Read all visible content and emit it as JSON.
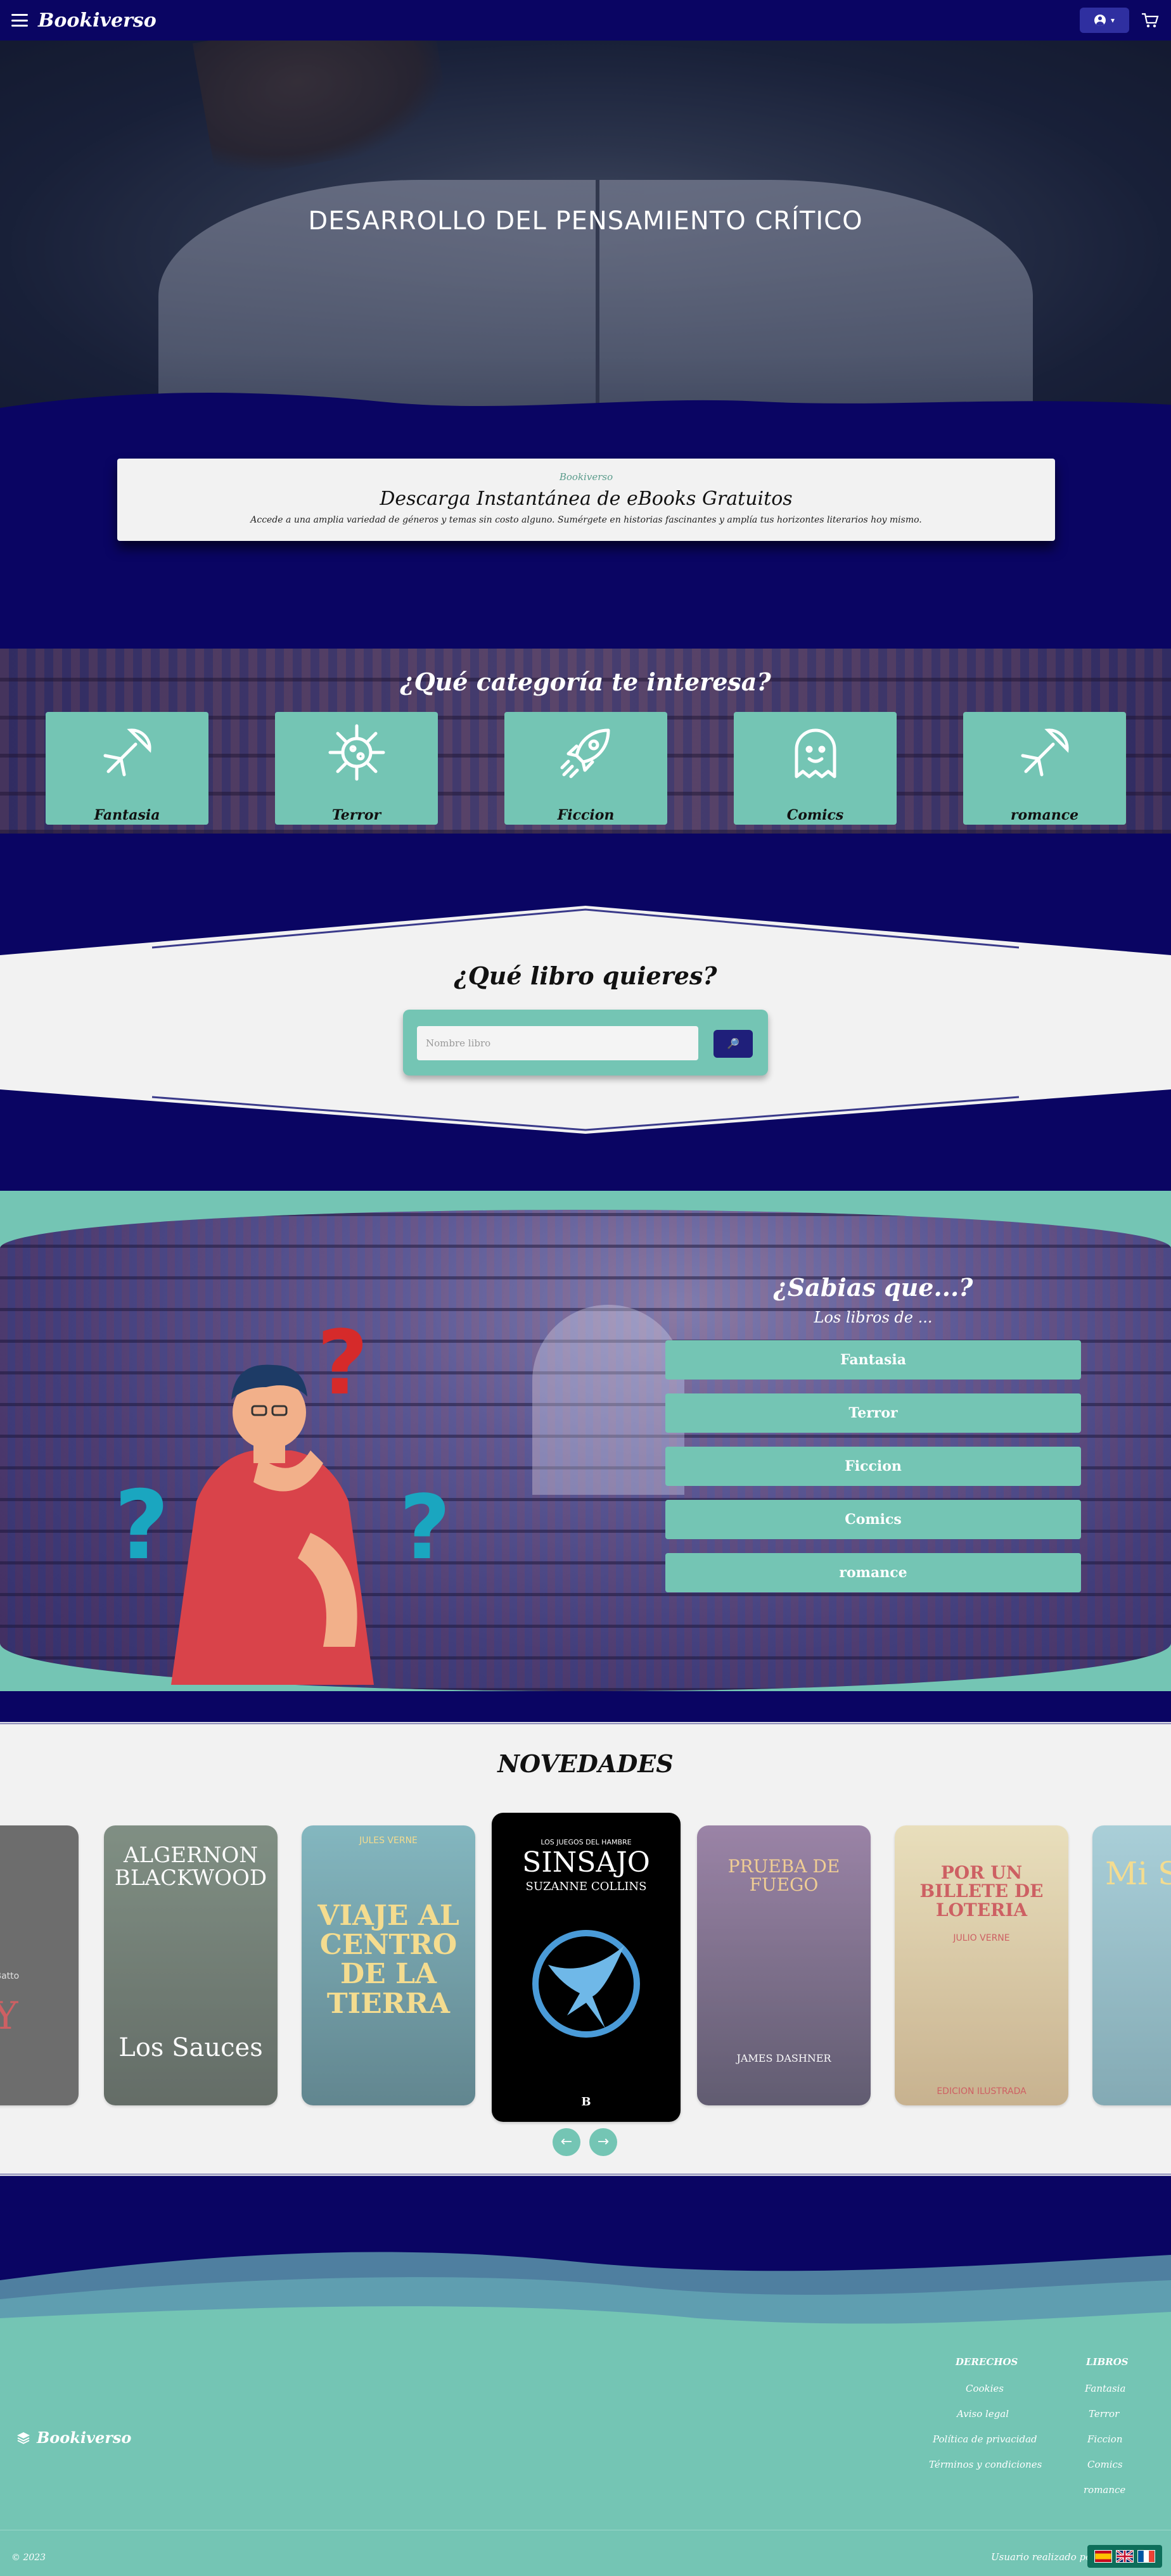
{
  "nav": {
    "brand": "Bookiverso",
    "user_caret": "▾"
  },
  "hero": {
    "title": "DESARROLLO DEL PENSAMIENTO CRÍTICO"
  },
  "info": {
    "small": "Bookiverso",
    "title": "Descarga Instantánea de eBooks Gratuitos",
    "description": "Accede a una amplia variedad de géneros y temas sin costo alguno. Sumérgete en historias fascinantes y amplía tus horizontes literarios hoy mismo."
  },
  "categories": {
    "title": "¿Qué categoría te interesa?",
    "items": [
      {
        "label": "Fantasia",
        "icon": "satellite-icon"
      },
      {
        "label": "Terror",
        "icon": "virus-icon"
      },
      {
        "label": "Ficcion",
        "icon": "rocket-icon"
      },
      {
        "label": "Comics",
        "icon": "ghost-icon"
      },
      {
        "label": "romance",
        "icon": "satellite-icon"
      }
    ]
  },
  "search": {
    "title": "¿Qué libro quieres?",
    "placeholder": "Nombre libro",
    "button_icon": "🔎"
  },
  "sabias": {
    "title": "¿Sabias que...?",
    "subtitle": "Los libros de ...",
    "buttons": [
      "Fantasia",
      "Terror",
      "Ficcion",
      "Comics",
      "romance"
    ]
  },
  "novedades": {
    "title": "NOVEDADES",
    "books": [
      {
        "title": "RY",
        "author": "Lesley Batto",
        "bg": "#3a3a3a"
      },
      {
        "title": "ALGERNON BLACKWOOD",
        "subtitle": "Los Sauces",
        "bg": "#3f4d42"
      },
      {
        "title": "VIAJE AL CENTRO DE LA TIERRA",
        "author": "JULES VERNE",
        "bg": "#3c7a86"
      },
      {
        "title": "SINSAJO",
        "author": "SUZANNE COLLINS",
        "series": "LOS JUEGOS DEL HAMBRE",
        "publisher": "B",
        "bg": "#000000"
      },
      {
        "title": "PRUEBA DE FUEGO",
        "author": "JAMES DASHNER",
        "bg": "#4a3a5a"
      },
      {
        "title": "POR UN BILLETE DE LOTERIA",
        "author": "JULIO VERNE",
        "edition": "EDICION ILUSTRADA",
        "bg": "#c8b88a"
      },
      {
        "title": "Mi Stro",
        "bg": "#7ab0c0"
      }
    ],
    "prev": "←",
    "next": "→"
  },
  "footer": {
    "brand": "Bookiverso",
    "derechos": {
      "heading": "DERECHOS",
      "links": [
        "Cookies",
        "Aviso legal",
        "Política de privacidad",
        "Términos y condiciones"
      ]
    },
    "libros": {
      "heading": "LIBROS",
      "links": [
        "Fantasia",
        "Terror",
        "Ficcion",
        "Comics",
        "romance"
      ]
    },
    "copyright": "© 2023",
    "made_by": "Usuario realizado po"
  }
}
